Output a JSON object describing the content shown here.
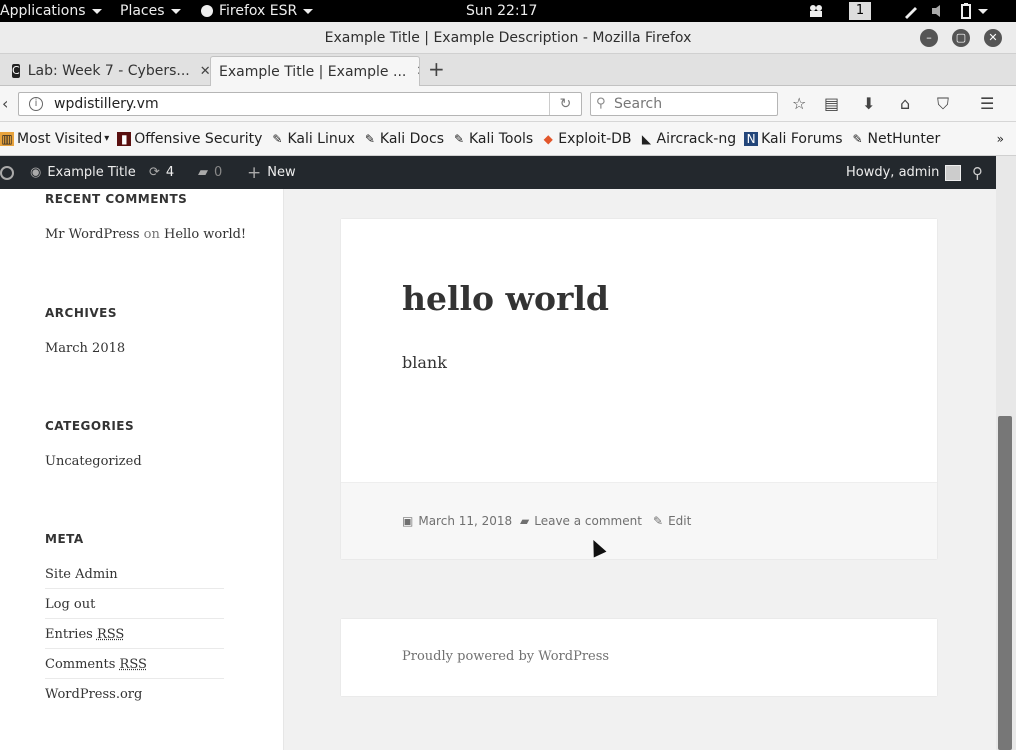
{
  "topbar": {
    "applications": "Applications",
    "places": "Places",
    "firefox": "Firefox ESR",
    "clock": "Sun 22:17",
    "workspace": "1"
  },
  "window": {
    "title": "Example Title | Example Description - Mozilla Firefox"
  },
  "tabs": [
    {
      "label": "Lab: Week 7 - Cybers...",
      "icon": "cyber-icon"
    },
    {
      "label": "Example Title | Example ...",
      "icon": ""
    }
  ],
  "nav": {
    "url": "wpdistillery.vm",
    "search_placeholder": "Search"
  },
  "bookmarks": {
    "most_visited": "Most Visited",
    "items": [
      "Offensive Security",
      "Kali Linux",
      "Kali Docs",
      "Kali Tools",
      "Exploit-DB",
      "Aircrack-ng",
      "Kali Forums",
      "NetHunter"
    ]
  },
  "wpbar": {
    "site": "Example Title",
    "updates": "4",
    "comments": "0",
    "new": "New",
    "howdy": "Howdy, admin"
  },
  "sidebar": {
    "recent_comments_title": "RECENT COMMENTS",
    "recent_author": "Mr WordPress",
    "recent_on": "on",
    "recent_post": "Hello world!",
    "archives_title": "ARCHIVES",
    "archives_item": "March 2018",
    "categories_title": "CATEGORIES",
    "categories_item": "Uncategorized",
    "meta_title": "META",
    "meta_site_admin": "Site Admin",
    "meta_logout": "Log out",
    "meta_entries": "Entries",
    "meta_comments": "Comments",
    "meta_rss": "RSS",
    "meta_wporg": "WordPress.org"
  },
  "post": {
    "title": "hello world",
    "body": "blank",
    "date": "March 11, 2018",
    "leave_comment": "Leave a comment",
    "edit": "Edit"
  },
  "footer": {
    "text": "Proudly powered by WordPress"
  }
}
